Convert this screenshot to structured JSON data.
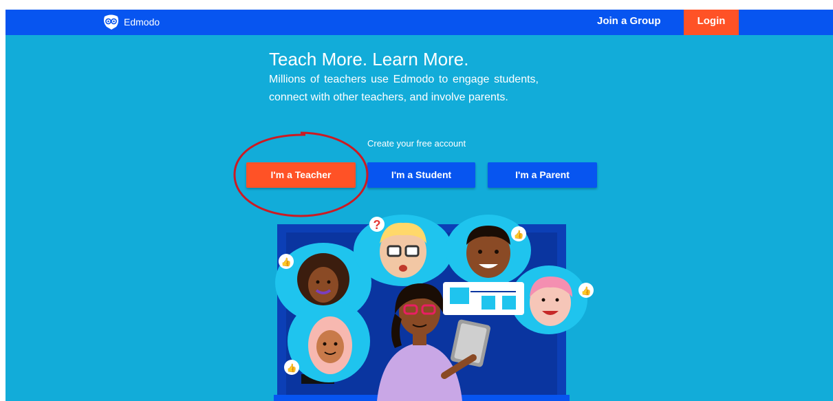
{
  "app": {
    "name": "Edmodo"
  },
  "colors": {
    "nav": "#0755f0",
    "background": "#12acd9",
    "accent": "#ff5226",
    "annotation": "#cc1a22"
  },
  "nav": {
    "brand_icon": "edmodo-owl-icon",
    "join_label": "Join a Group",
    "login_label": "Login"
  },
  "hero": {
    "title": "Teach More. Learn More.",
    "body": "Millions of teachers use Edmodo to engage students, connect with other teachers, and involve parents.",
    "cta_label": "Create your free account",
    "buttons": {
      "teacher": "I'm a Teacher",
      "student": "I'm a Student",
      "parent": "I'm a Parent"
    }
  },
  "annotation": {
    "shape": "ellipse",
    "target": "teacher-button"
  },
  "illustration": {
    "icons": [
      "thumbs-up-icon",
      "question-mark-icon",
      "tablet-icon",
      "chart-card-icon"
    ]
  }
}
